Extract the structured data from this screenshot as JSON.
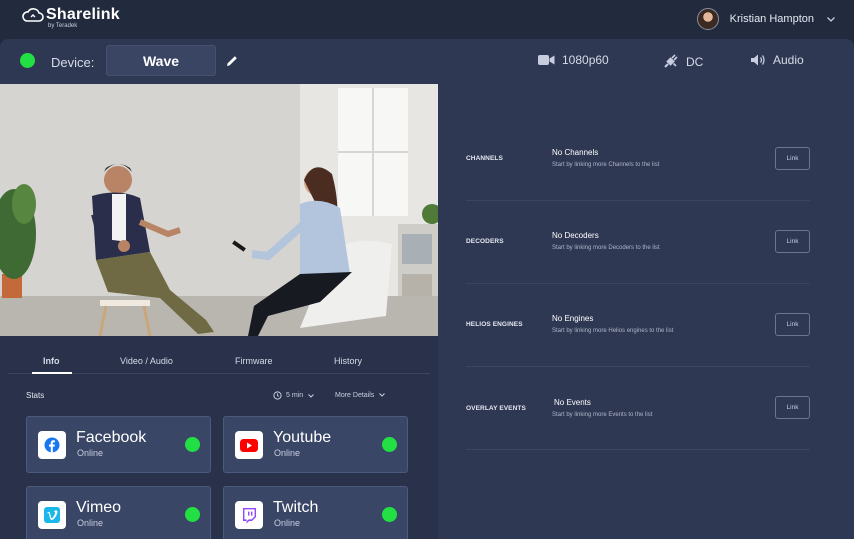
{
  "app": {
    "logo_text": "Sharelink",
    "logo_sub": "by Teradek"
  },
  "user": {
    "name": "Kristian Hampton"
  },
  "device": {
    "label": "Device:",
    "name": "Wave",
    "status_color": "#22e044",
    "resolution": "1080p60",
    "power": "DC",
    "audio": "Audio"
  },
  "tabs": [
    "Info",
    "Video / Audio",
    "Firmware",
    "History"
  ],
  "stats": {
    "label": "Stats",
    "interval": "5 min",
    "more": "More Details"
  },
  "platforms": [
    {
      "name": "Facebook",
      "status": "Online",
      "icon": "facebook-icon"
    },
    {
      "name": "Youtube",
      "status": "Online",
      "icon": "youtube-icon"
    },
    {
      "name": "Vimeo",
      "status": "Online",
      "icon": "vimeo-icon"
    },
    {
      "name": "Twitch",
      "status": "Online",
      "icon": "twitch-icon"
    }
  ],
  "links": [
    {
      "label": "CHANNELS",
      "title": "No Channels",
      "subtitle": "Start by linking more Channels to the list",
      "button": "Link"
    },
    {
      "label": "DECODERS",
      "title": "No Decoders",
      "subtitle": "Start by linking more Decoders to the list",
      "button": "Link"
    },
    {
      "label": "HELIOS ENGINES",
      "title": "No Engines",
      "subtitle": "Start by linking more Helios engines to the list",
      "button": "Link"
    },
    {
      "label": "OVERLAY EVENTS",
      "title": "No Events",
      "subtitle": "Start by linking more Events to the list",
      "button": "Link"
    }
  ],
  "colors": {
    "online": "#22e044",
    "panel": "#2f3853",
    "background": "#222a3e"
  }
}
